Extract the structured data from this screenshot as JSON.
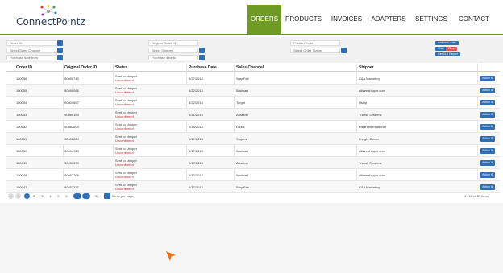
{
  "brand": {
    "name": "ConnectPointz"
  },
  "nav": {
    "orders": "ORDERS",
    "products": "PRODUCTS",
    "invoices": "INVOICES",
    "adapters": "ADAPTERS",
    "settings": "SETTINGS",
    "contact": "CONTACT"
  },
  "filters": {
    "order_id": "Order ID",
    "original_order_id": "Original Order ID",
    "product_code": "Product Code",
    "sales_channel": "Select Sales Channel",
    "shipper": "Select Shipper",
    "order_status": "Select Order Status",
    "purchase_date_from": "Purchase date from",
    "purchase_date_to": "Purchase date to",
    "add_new_order": "Add new order",
    "filter": "Filter",
    "clear": "Clear",
    "get_xls": "Get XLS Report"
  },
  "table": {
    "headers": {
      "order_id": "Order ID",
      "original_order_id": "Original Order ID",
      "status": "Status",
      "purchase_date": "Purchase Date",
      "sales_channel": "Sales Channel",
      "shipper": "Shipper"
    },
    "action_label": "Action ⚙",
    "rows": [
      {
        "order_id": "100056",
        "original": "90890740",
        "status1": "Sent to shipper",
        "status2": "Unconfirmed",
        "date": "6/27/2015",
        "channel": "Way Fair",
        "shipper": "C&A Marketing"
      },
      {
        "order_id": "100055",
        "original": "90890066",
        "status1": "Sent to shipper",
        "status2": "Unconfirmed",
        "date": "6/22/2015",
        "channel": "Walmart",
        "shipper": "citizenshipper.com"
      },
      {
        "order_id": "100054",
        "original": "90804657",
        "status1": "Sent to shipper",
        "status2": "Unconfirmed",
        "date": "6/22/2015",
        "channel": "Target",
        "shipper": "Uship"
      },
      {
        "order_id": "100053",
        "original": "90889150",
        "status1": "Sent to shipper",
        "status2": "Unconfirmed",
        "date": "6/21/2015",
        "channel": "Amazon",
        "shipper": "Transit Systems"
      },
      {
        "order_id": "100052",
        "original": "90882650",
        "status1": "Sent to shipper",
        "status2": "Unconfirmed",
        "date": "6/18/2015",
        "channel": "Dick's",
        "shipper": "Fishel International"
      },
      {
        "order_id": "100051",
        "original": "90808824",
        "status1": "Sent to shipper",
        "status2": "Unconfirmed",
        "date": "6/17/2015",
        "channel": "Staples",
        "shipper": "Freight Center"
      },
      {
        "order_id": "100050",
        "original": "90854929",
        "status1": "Sent to shipper",
        "status2": "Unconfirmed",
        "date": "6/17/2015",
        "channel": "Walmart",
        "shipper": "citizenshipper.com"
      },
      {
        "order_id": "100049",
        "original": "90853479",
        "status1": "Sent to shipper",
        "status2": "Unconfirmed",
        "date": "6/17/2015",
        "channel": "Amazon",
        "shipper": "Transit Systems"
      },
      {
        "order_id": "100048",
        "original": "90852796",
        "status1": "Sent to shipper",
        "status2": "Unconfirmed",
        "date": "6/17/2015",
        "channel": "Walmart",
        "shipper": "citizenshipper.com"
      },
      {
        "order_id": "100047",
        "original": "90852377",
        "status1": "Sent to shipper",
        "status2": "Unconfirmed",
        "date": "6/17/2015",
        "channel": "Way Fair",
        "shipper": "C&A Marketing"
      }
    ]
  },
  "pagination": {
    "pages": [
      "1",
      "2",
      "3",
      "4",
      "5",
      "6"
    ],
    "per_page_value": "10",
    "per_page_label": "Items per page",
    "summary": "1 - 10 of 57 items"
  },
  "colors": {
    "accent": "#6f9a23",
    "primary": "#2f6db5",
    "danger": "#cc1f1f",
    "cursor": "#e8731a"
  }
}
